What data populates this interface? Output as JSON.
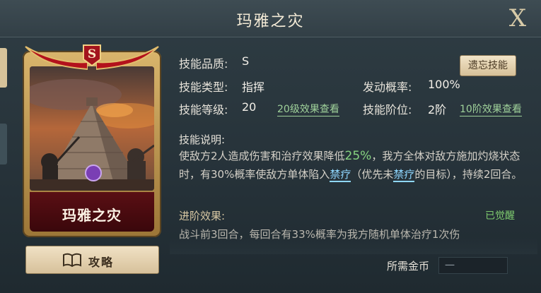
{
  "title": "玛雅之灾",
  "close_label": "X",
  "card": {
    "rank": "S",
    "name": "玛雅之灾"
  },
  "guide_button": "攻略",
  "forget_button": "遗忘技能",
  "fields": {
    "quality_label": "技能品质:",
    "quality_value": "S",
    "type_label": "技能类型:",
    "type_value": "指挥",
    "rate_label": "发动概率:",
    "rate_value": "100%",
    "level_label": "技能等级:",
    "level_value": "20",
    "level_link": "20级效果查看",
    "stage_label": "技能阶位:",
    "stage_value": "2阶",
    "stage_link": "10阶效果查看"
  },
  "description": {
    "title": "技能说明:",
    "p1": "使敌方2人造成伤害和治疗效果降低",
    "pct": "25%",
    "p2": "，我方全体对敌方施加灼烧状态时，有30%概率使敌方单体陷入",
    "kw1": "禁疗",
    "p3": "（优先未",
    "kw2": "禁疗",
    "p4": "的目标），持续2回合。"
  },
  "advanced": {
    "title": "进阶效果:",
    "status": "已觉醒",
    "text": "战斗前3回合，每回合有33%概率为我方随机单体治疗1次伤"
  },
  "cost": {
    "label": "所需金币",
    "value": "一"
  },
  "icons": {
    "close": "close-icon",
    "guide": "book-icon",
    "rank": "rank-badge-icon"
  },
  "colors": {
    "accent_green": "#86d480",
    "keyword_blue": "#8fd7ff",
    "card_red": "#5a0f14"
  }
}
